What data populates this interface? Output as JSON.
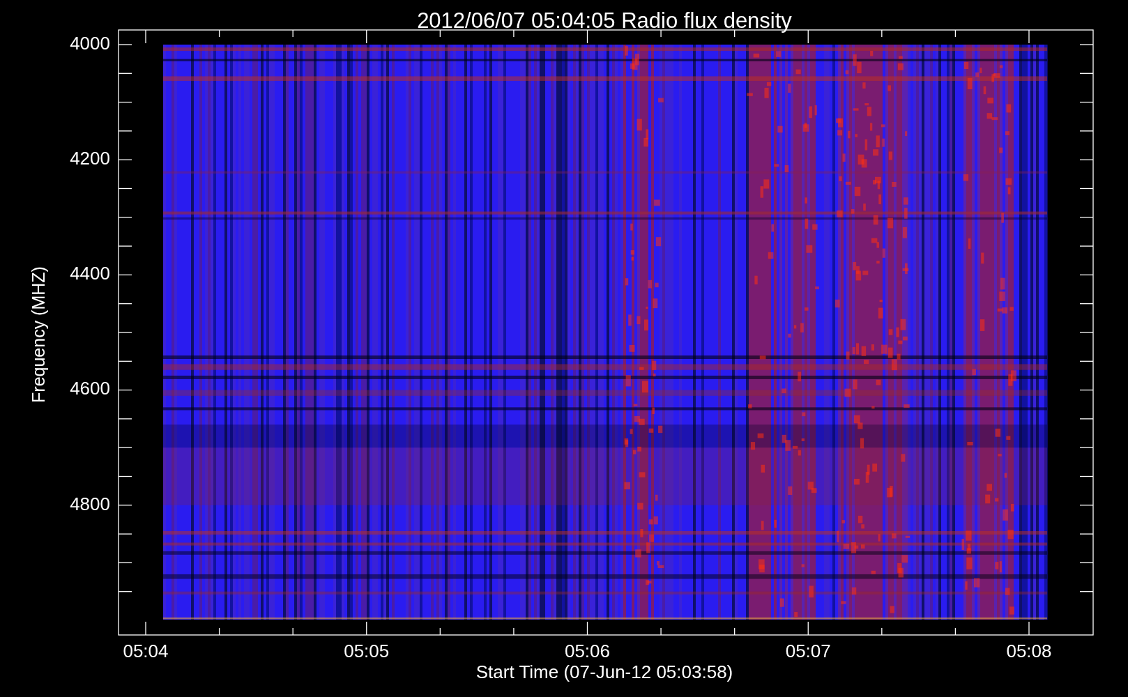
{
  "title": "2012/06/07 05:04:05 Radio flux density",
  "y_axis": {
    "label": "Frequency (MHZ)",
    "ticks": [
      "4000",
      "4200",
      "4400",
      "4600",
      "4800"
    ]
  },
  "x_axis": {
    "label": "Start Time (07-Jun-12 05:03:58)",
    "ticks": [
      "05:04",
      "05:05",
      "05:06",
      "05:07",
      "05:08"
    ]
  }
}
